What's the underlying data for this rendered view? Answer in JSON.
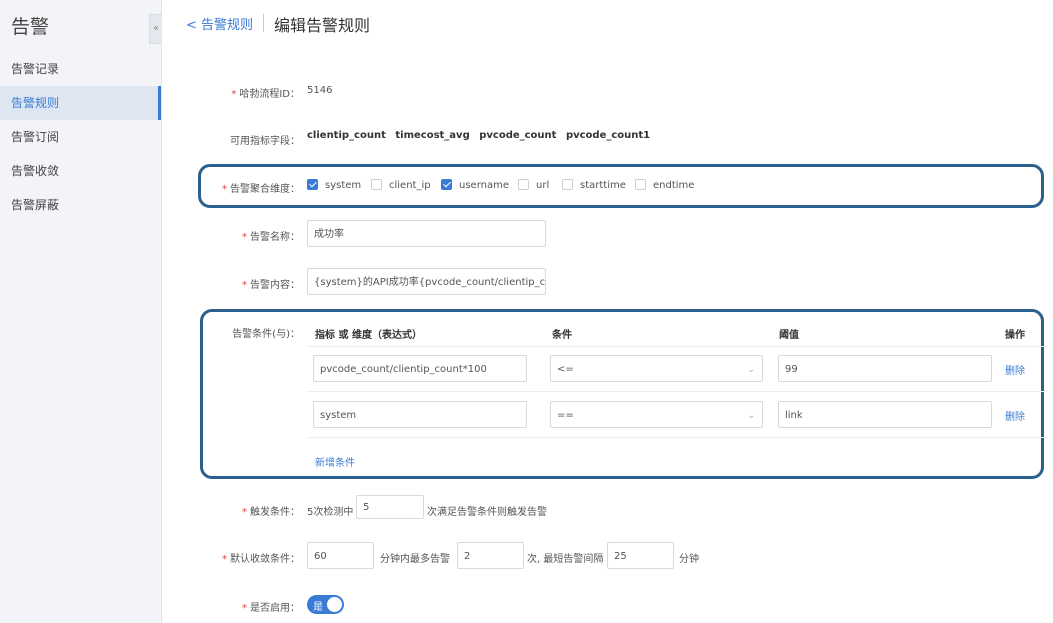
{
  "sidebar": {
    "title": "告警",
    "collapse_icon": "«",
    "items": [
      {
        "label": "告警记录",
        "active": false
      },
      {
        "label": "告警规则",
        "active": true
      },
      {
        "label": "告警订阅",
        "active": false
      },
      {
        "label": "告警收敛",
        "active": false
      },
      {
        "label": "告警屏蔽",
        "active": false
      }
    ]
  },
  "header": {
    "back_label": "< 告警规则",
    "title": "编辑告警规则"
  },
  "form": {
    "required_mark": "*",
    "process_id": {
      "label": "哈勃流程ID：",
      "value": "5146"
    },
    "fields": {
      "label": "可用指标字段：",
      "values": [
        "clientip_count",
        "timecost_avg",
        "pvcode_count",
        "pvcode_count1"
      ]
    },
    "dimensions": {
      "label": "告警聚合维度：",
      "options": [
        {
          "label": "system",
          "checked": true
        },
        {
          "label": "client_ip",
          "checked": false
        },
        {
          "label": "username",
          "checked": true
        },
        {
          "label": "url",
          "checked": false
        },
        {
          "label": "starttime",
          "checked": false
        },
        {
          "label": "endtime",
          "checked": false
        }
      ]
    },
    "name": {
      "label": "告警名称：",
      "value": "成功率"
    },
    "content": {
      "label": "告警内容：",
      "value": "{system}的API成功率{pvcode_count/clientip_cour"
    },
    "conditions": {
      "label": "告警条件(与)：",
      "headers": {
        "metric": "指标 或 维度（表达式）",
        "condition": "条件",
        "threshold": "阈值",
        "action": "操作"
      },
      "rows": [
        {
          "metric": "pvcode_count/clientip_count*100",
          "operator": "<=",
          "threshold": "99",
          "action": "删除"
        },
        {
          "metric": "system",
          "operator": "==",
          "threshold": "link",
          "action": "删除"
        }
      ],
      "add_label": "新增条件",
      "dropdown_icon": "⌄"
    },
    "trigger": {
      "label": "触发条件：",
      "prefix": "5次检测中",
      "value": "5",
      "suffix": "次满足告警条件则触发告警"
    },
    "convergence": {
      "label": "默认收敛条件：",
      "minutes": "60",
      "text1": "分钟内最多告警",
      "max_alerts": "2",
      "text2": "次, 最短告警间隔",
      "interval": "25",
      "text3": "分钟"
    },
    "enabled": {
      "label": "是否启用：",
      "toggle_text": "是",
      "on": true
    }
  }
}
